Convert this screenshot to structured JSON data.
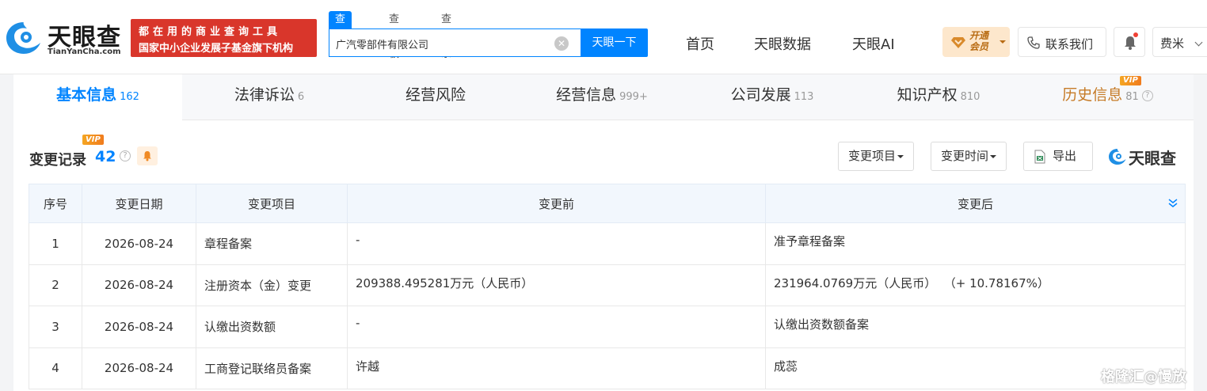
{
  "header": {
    "logo_text": "天眼查",
    "logo_url": "TianYanCha.com",
    "promo_line1": "都在用的商业查询工具",
    "promo_line2": "国家中小企业发展子基金旗下机构",
    "search_tabs": [
      "查公司",
      "查老板",
      "查关系"
    ],
    "search_value": "广汽零部件有限公司",
    "search_button": "天眼一下",
    "nav": [
      "首页",
      "天眼数据",
      "天眼AI"
    ],
    "vip_button": "开通\n会员",
    "contact": "联系我们",
    "user": "费米"
  },
  "tabs": [
    {
      "label": "基本信息",
      "count": "162"
    },
    {
      "label": "法律诉讼",
      "count": "6"
    },
    {
      "label": "经营风险",
      "count": ""
    },
    {
      "label": "经营信息",
      "count": "999+"
    },
    {
      "label": "公司发展",
      "count": "113"
    },
    {
      "label": "知识产权",
      "count": "810"
    },
    {
      "label": "历史信息",
      "count": "81",
      "badge": "VIP"
    }
  ],
  "section": {
    "title": "变更记录",
    "count": "42",
    "badge": "VIP",
    "filter_item": "变更项目",
    "filter_time": "变更时间",
    "export": "导出",
    "brand": "天眼查"
  },
  "table": {
    "headers": [
      "序号",
      "变更日期",
      "变更项目",
      "变更前",
      "变更后"
    ],
    "rows": [
      {
        "no": "1",
        "date": "2026-08-24",
        "item": "章程备案",
        "before": "-",
        "after": "准予章程备案"
      },
      {
        "no": "2",
        "date": "2026-08-24",
        "item": "注册资本（金）变更",
        "before": "209388.495281万元（人民币）",
        "after": "231964.0769万元（人民币）  （+ 10.78167%）"
      },
      {
        "no": "3",
        "date": "2026-08-24",
        "item": "认缴出资数额",
        "before": "-",
        "after": "认缴出资数额备案"
      },
      {
        "no": "4",
        "date": "2026-08-24",
        "item": "工商登记联络员备案",
        "before": "许越",
        "after": "成蕊"
      }
    ]
  },
  "watermark": "格隆汇@慢放",
  "colors": {
    "primary": "#0084ff",
    "promo": "#d9362b",
    "changed": "#d9573f",
    "vip": "#c67b27"
  }
}
